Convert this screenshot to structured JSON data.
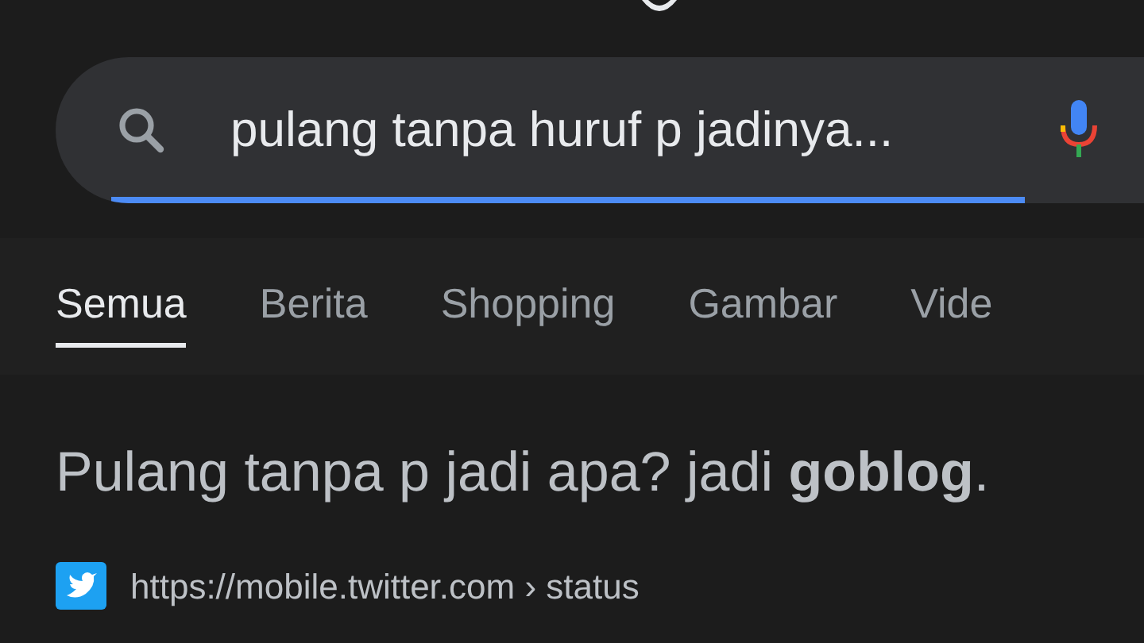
{
  "search": {
    "value": "pulang tanpa huruf p jadinya..."
  },
  "tabs": [
    {
      "label": "Semua",
      "selected": true
    },
    {
      "label": "Berita",
      "selected": false
    },
    {
      "label": "Shopping",
      "selected": false
    },
    {
      "label": "Gambar",
      "selected": false
    },
    {
      "label": "Vide",
      "selected": false
    }
  ],
  "result": {
    "title": "Pulang tanpa p jadi apa? jadi **goblog**.",
    "url": "https://mobile.twitter.com › status"
  }
}
